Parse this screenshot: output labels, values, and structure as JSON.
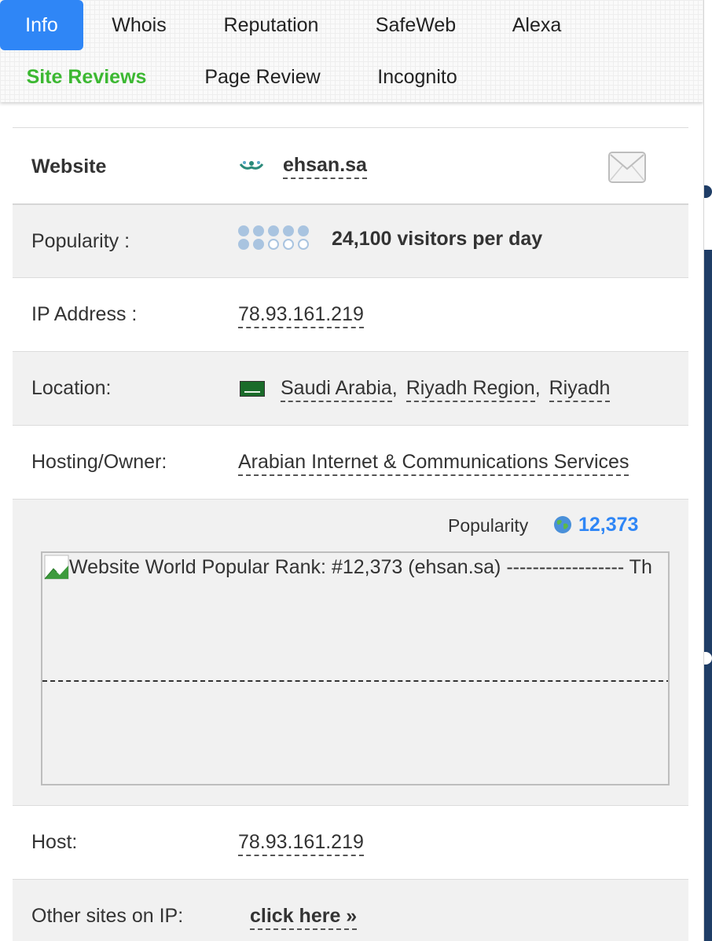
{
  "tabs": [
    {
      "label": "Info",
      "active": true
    },
    {
      "label": "Whois"
    },
    {
      "label": "Reputation"
    },
    {
      "label": "SafeWeb"
    },
    {
      "label": "Alexa"
    },
    {
      "label": "Site Reviews",
      "highlight": "#3cb832"
    },
    {
      "label": "Page Review"
    },
    {
      "label": "Incognito"
    }
  ],
  "website": {
    "label": "Website",
    "domain": "ehsan.sa",
    "mail_icon": "envelope-icon",
    "logo_icon": "site-logo-icon"
  },
  "popularity": {
    "label": "Popularity :",
    "text": "24,100 visitors per day",
    "dots_on": 7,
    "dots_total": 10
  },
  "ip": {
    "label": "IP Address :",
    "value": "78.93.161.219"
  },
  "location": {
    "label": "Location:",
    "country": "Saudi Arabia",
    "region": "Riyadh Region",
    "city": "Riyadh",
    "sep": ","
  },
  "hosting": {
    "label": "Hosting/Owner:",
    "value": "Arabian Internet & Communications Services"
  },
  "rank": {
    "label": "Popularity",
    "value": "12,373",
    "alt_text": "Website World Popular Rank: #12,373 (ehsan.sa) ------------------ Th"
  },
  "host": {
    "label": "Host:",
    "value": "78.93.161.219"
  },
  "other_sites": {
    "label": "Other sites on IP:",
    "link": "click here »"
  },
  "colors": {
    "accent": "#2f86f6",
    "green": "#3cb832",
    "row_gray": "#f1f1f1"
  }
}
